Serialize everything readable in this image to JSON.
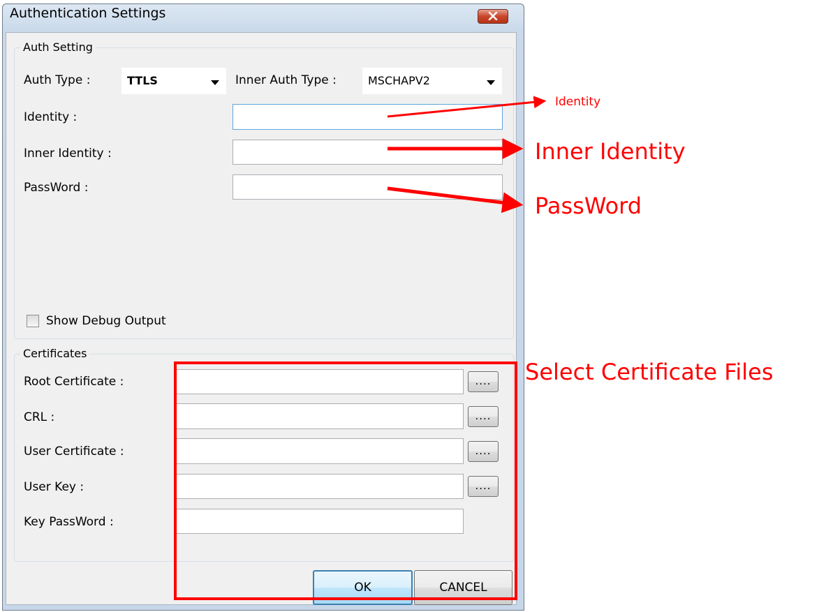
{
  "window": {
    "title": "Authentication Settings"
  },
  "auth_group": {
    "title": "Auth Setting",
    "auth_type_label": "Auth Type :",
    "auth_type_value": "TTLS",
    "inner_auth_type_label": "Inner Auth Type :",
    "inner_auth_type_value": "MSCHAPV2",
    "identity_label": "Identity :",
    "identity_value": "",
    "inner_identity_label": "Inner Identity :",
    "inner_identity_value": "",
    "password_label": "PassWord :",
    "password_value": "",
    "show_debug_label": "Show Debug Output",
    "show_debug_checked": false
  },
  "cert_group": {
    "title": "Certificates",
    "root_cert_label": "Root Certificate :",
    "crl_label": "CRL :",
    "user_cert_label": "User Certificate :",
    "user_key_label": "User Key :",
    "key_password_label": "Key PassWord :",
    "browse_label": "...."
  },
  "buttons": {
    "ok": "OK",
    "cancel": "CANCEL"
  },
  "annotations": {
    "identity": "Identity",
    "inner_identity": "Inner Identity",
    "password": "PassWord",
    "select_cert": "Select Certificate Files",
    "color": "#ff0000"
  }
}
